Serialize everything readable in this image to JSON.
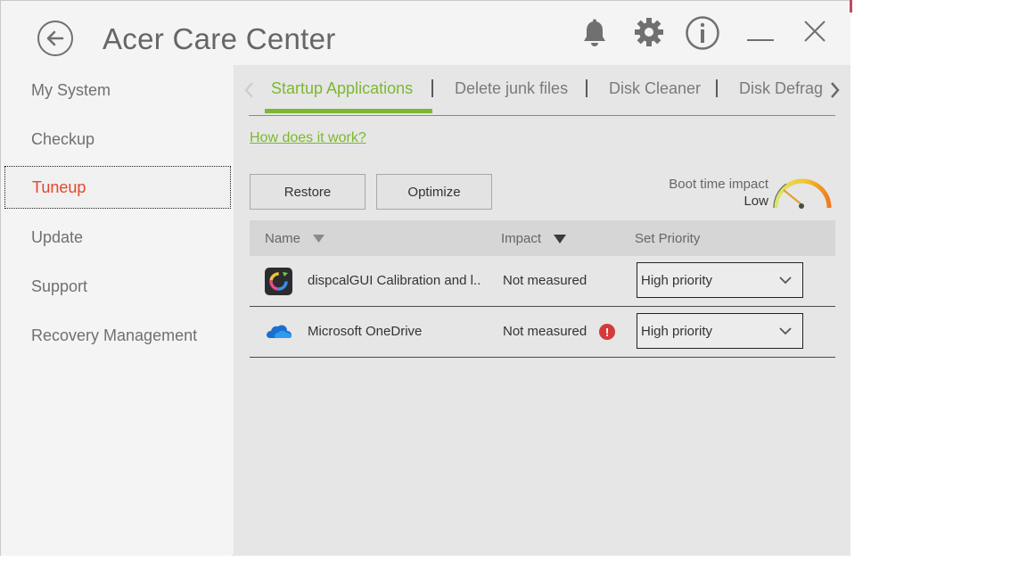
{
  "window": {
    "title": "Acer Care Center"
  },
  "sidebar": {
    "items": [
      {
        "label": "My System"
      },
      {
        "label": "Checkup"
      },
      {
        "label": "Tuneup"
      },
      {
        "label": "Update"
      },
      {
        "label": "Support"
      },
      {
        "label": "Recovery Management"
      }
    ],
    "active": "Tuneup"
  },
  "tabs": [
    {
      "label": "Startup Applications"
    },
    {
      "label": "Delete junk files"
    },
    {
      "label": "Disk Cleaner"
    },
    {
      "label": "Disk Defrag"
    }
  ],
  "how_link": "How does it work?",
  "buttons": {
    "restore": "Restore",
    "optimize": "Optimize"
  },
  "boot": {
    "label": "Boot time impact",
    "value": "Low"
  },
  "table": {
    "headers": {
      "name": "Name",
      "impact": "Impact",
      "priority": "Set Priority"
    },
    "rows": [
      {
        "name": "dispcalGUI Calibration and l..",
        "impact": "Not measured",
        "priority": "High priority",
        "icon": "dispcalgui-icon",
        "warning": false
      },
      {
        "name": "Microsoft OneDrive",
        "impact": "Not measured",
        "priority": "High priority",
        "icon": "onedrive-icon",
        "warning": true
      }
    ]
  },
  "icons": {
    "titlebar": [
      "back-arrow-icon",
      "bell-icon",
      "gear-icon",
      "info-icon",
      "minimize-icon",
      "close-icon"
    ]
  },
  "colors": {
    "accent_green": "#7cb82f",
    "active_red": "#e5462c",
    "warning_red": "#d33b3b"
  }
}
